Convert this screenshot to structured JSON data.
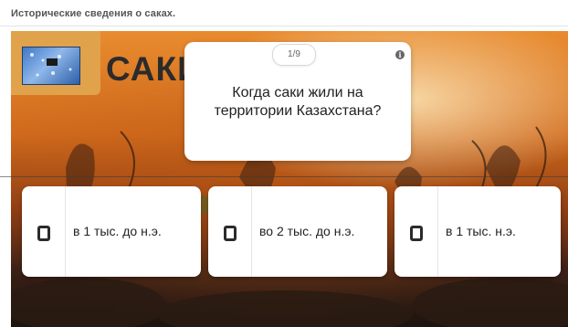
{
  "page": {
    "title": "Исторические сведения о саках."
  },
  "cover": {
    "title": "САКИ"
  },
  "question": {
    "counter": "1/9",
    "info_symbol": "i",
    "text": "Когда саки жили на территории Казахстана?"
  },
  "answers": [
    {
      "label": "в 1 тыс. до н.э."
    },
    {
      "label": "во 2 тыс. до н.э."
    },
    {
      "label": "в 1 тыс. н.э."
    }
  ]
}
